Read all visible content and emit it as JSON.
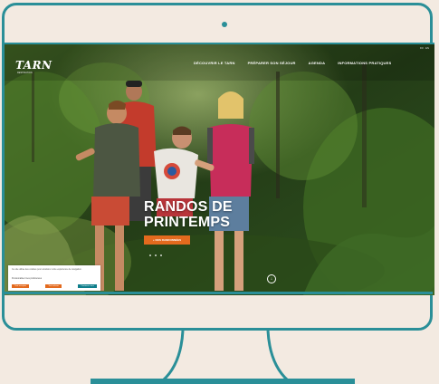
{
  "site": {
    "logo": "TARN",
    "logo_sub": "DESTINATION"
  },
  "nav": {
    "items": [
      "DÉCOUVRIR LE TARN",
      "PRÉPARER SON SÉJOUR",
      "AGENDA",
      "INFORMATIONS PRATIQUES"
    ],
    "lang": "FR · EN"
  },
  "hero": {
    "title_line1": "RANDOS DE",
    "title_line2": "PRINTEMPS",
    "cta_label": "+ NOS RANDONNÉES"
  },
  "cookie": {
    "text": "Ce site utilise des cookies pour améliorer votre expérience de navigation.",
    "link": "Personnaliser mes préférences",
    "accept": "Tout accepter",
    "refuse": "Tout refuser",
    "continue": "Continuer sans"
  },
  "colors": {
    "frame": "#2a8f98",
    "background": "#f3eae1",
    "accent": "#e36a1e"
  }
}
